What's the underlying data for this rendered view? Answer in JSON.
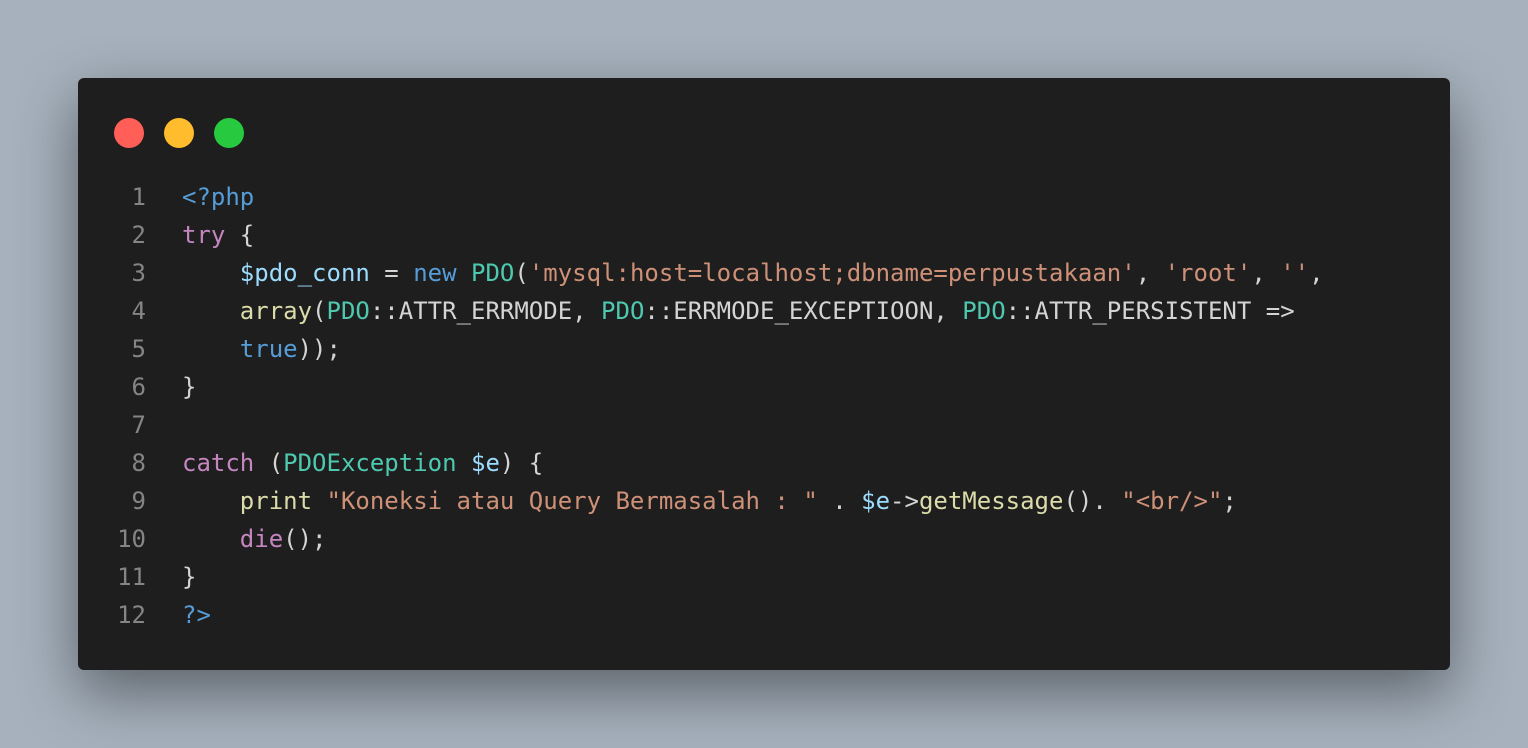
{
  "colors": {
    "background": "#a6b1bd",
    "editor_bg": "#1e1e1e",
    "dot_red": "#ff5f56",
    "dot_yellow": "#ffbd2e",
    "dot_green": "#27c93f",
    "line_number": "#858585",
    "plain": "#d4d4d4",
    "control_keyword": "#c586c0",
    "keyword": "#569cd6",
    "variable": "#9cdcfe",
    "type": "#4ec9b0",
    "string": "#ce9178",
    "function": "#dcdcaa"
  },
  "window_controls": [
    {
      "name": "close-dot",
      "color_key": "dot_red"
    },
    {
      "name": "minimize-dot",
      "color_key": "dot_yellow"
    },
    {
      "name": "maximize-dot",
      "color_key": "dot_green"
    }
  ],
  "code": {
    "lines": [
      {
        "number": "1",
        "tokens": [
          {
            "t": "<?php",
            "c": "keyword"
          }
        ]
      },
      {
        "number": "2",
        "tokens": [
          {
            "t": "try",
            "c": "control_keyword"
          },
          {
            "t": " {",
            "c": "plain"
          }
        ]
      },
      {
        "number": "3",
        "tokens": [
          {
            "t": "    ",
            "c": "plain"
          },
          {
            "t": "$pdo_conn",
            "c": "variable"
          },
          {
            "t": " = ",
            "c": "plain"
          },
          {
            "t": "new",
            "c": "keyword"
          },
          {
            "t": " ",
            "c": "plain"
          },
          {
            "t": "PDO",
            "c": "type"
          },
          {
            "t": "(",
            "c": "plain"
          },
          {
            "t": "'mysql:host=localhost;dbname=perpustakaan'",
            "c": "string"
          },
          {
            "t": ", ",
            "c": "plain"
          },
          {
            "t": "'root'",
            "c": "string"
          },
          {
            "t": ", ",
            "c": "plain"
          },
          {
            "t": "''",
            "c": "string"
          },
          {
            "t": ",",
            "c": "plain"
          }
        ]
      },
      {
        "number": "4",
        "tokens": [
          {
            "t": "    ",
            "c": "plain"
          },
          {
            "t": "array",
            "c": "function"
          },
          {
            "t": "(",
            "c": "plain"
          },
          {
            "t": "PDO",
            "c": "type"
          },
          {
            "t": "::ATTR_ERRMODE, ",
            "c": "plain"
          },
          {
            "t": "PDO",
            "c": "type"
          },
          {
            "t": "::ERRMODE_EXCEPTIOON, ",
            "c": "plain"
          },
          {
            "t": "PDO",
            "c": "type"
          },
          {
            "t": "::ATTR_PERSISTENT =>",
            "c": "plain"
          }
        ]
      },
      {
        "number": "5",
        "tokens": [
          {
            "t": "    ",
            "c": "plain"
          },
          {
            "t": "true",
            "c": "keyword"
          },
          {
            "t": "));",
            "c": "plain"
          }
        ]
      },
      {
        "number": "6",
        "tokens": [
          {
            "t": "}",
            "c": "plain"
          }
        ]
      },
      {
        "number": "7",
        "tokens": []
      },
      {
        "number": "8",
        "tokens": [
          {
            "t": "catch",
            "c": "control_keyword"
          },
          {
            "t": " (",
            "c": "plain"
          },
          {
            "t": "PDOException",
            "c": "type"
          },
          {
            "t": " ",
            "c": "plain"
          },
          {
            "t": "$e",
            "c": "variable"
          },
          {
            "t": ") {",
            "c": "plain"
          }
        ]
      },
      {
        "number": "9",
        "tokens": [
          {
            "t": "    ",
            "c": "plain"
          },
          {
            "t": "print",
            "c": "function"
          },
          {
            "t": " ",
            "c": "plain"
          },
          {
            "t": "\"Koneksi atau Query Bermasalah : \"",
            "c": "string"
          },
          {
            "t": " . ",
            "c": "plain"
          },
          {
            "t": "$e",
            "c": "variable"
          },
          {
            "t": "->",
            "c": "plain"
          },
          {
            "t": "getMessage",
            "c": "function"
          },
          {
            "t": "(). ",
            "c": "plain"
          },
          {
            "t": "\"<br/>\"",
            "c": "string"
          },
          {
            "t": ";",
            "c": "plain"
          }
        ]
      },
      {
        "number": "10",
        "tokens": [
          {
            "t": "    ",
            "c": "plain"
          },
          {
            "t": "die",
            "c": "control_keyword"
          },
          {
            "t": "();",
            "c": "plain"
          }
        ]
      },
      {
        "number": "11",
        "tokens": [
          {
            "t": "}",
            "c": "plain"
          }
        ]
      },
      {
        "number": "12",
        "tokens": [
          {
            "t": "?>",
            "c": "keyword"
          }
        ]
      }
    ]
  }
}
